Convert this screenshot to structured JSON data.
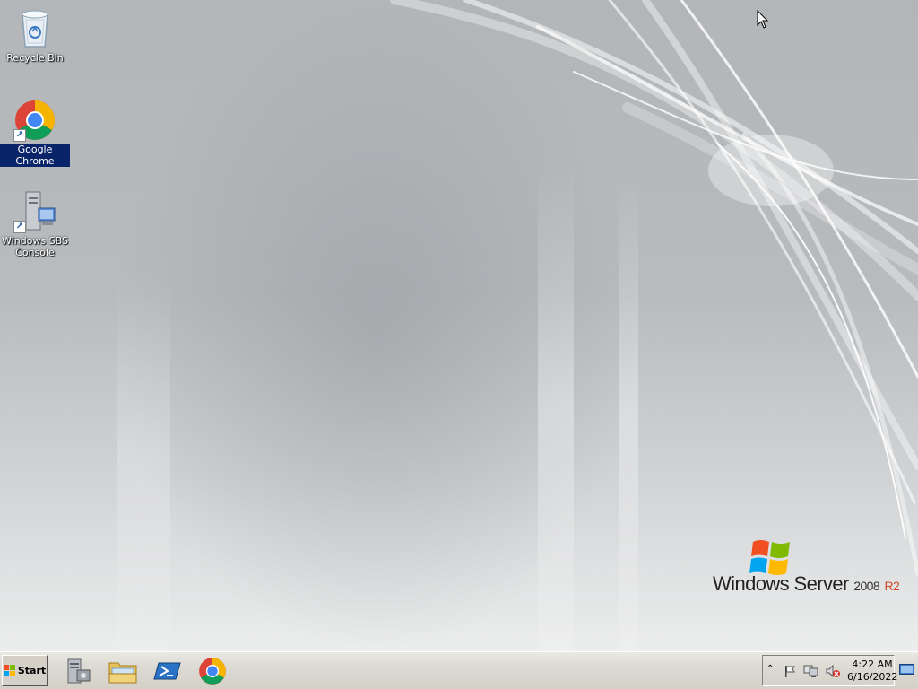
{
  "desktop": {
    "icons": [
      {
        "label": "Recycle Bin",
        "icon": "recycle-bin-icon"
      },
      {
        "label": "Google Chrome",
        "icon": "chrome-icon",
        "selected": true
      },
      {
        "label": "Windows SBS Console",
        "icon": "server-console-icon"
      }
    ],
    "logo": {
      "brand": "Windows Server",
      "version": "2008",
      "edition": "R2"
    }
  },
  "taskbar": {
    "start_label": "Start",
    "pinned": [
      {
        "name": "server-manager",
        "icon": "server-manager-icon"
      },
      {
        "name": "windows-explorer",
        "icon": "folder-icon"
      },
      {
        "name": "powershell",
        "icon": "powershell-icon"
      },
      {
        "name": "google-chrome",
        "icon": "chrome-icon"
      }
    ],
    "tray": {
      "icons": [
        "show-hidden-icons-icon",
        "action-center-flag-icon",
        "network-icon",
        "volume-muted-icon"
      ],
      "time": "4:22 AM",
      "date": "6/16/2022"
    }
  },
  "colors": {
    "selection": "#0a246a",
    "taskbar": "#d4d0c8",
    "edition_red": "#d24a2b"
  }
}
